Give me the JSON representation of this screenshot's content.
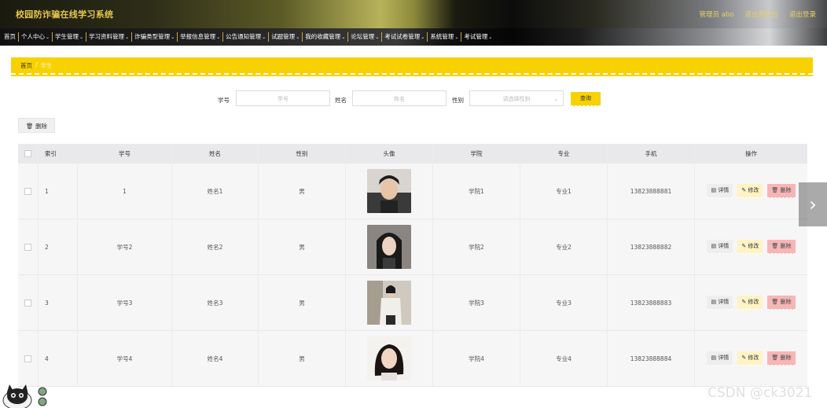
{
  "app": {
    "title": "校园防诈骗在线学习系统"
  },
  "top_right": {
    "user_label": "管理员 abo",
    "back_label": "退出到前台",
    "logout_label": "退出登录"
  },
  "nav": [
    {
      "label": "首页",
      "has_menu": false
    },
    {
      "label": "个人中心",
      "has_menu": true
    },
    {
      "label": "学生管理",
      "has_menu": true
    },
    {
      "label": "学习资料管理",
      "has_menu": true
    },
    {
      "label": "诈骗类型管理",
      "has_menu": true
    },
    {
      "label": "举报信息管理",
      "has_menu": true
    },
    {
      "label": "公告通知管理",
      "has_menu": true
    },
    {
      "label": "试题管理",
      "has_menu": true
    },
    {
      "label": "我的收藏管理",
      "has_menu": true
    },
    {
      "label": "论坛管理",
      "has_menu": true
    },
    {
      "label": "考试试卷管理",
      "has_menu": true
    },
    {
      "label": "系统管理",
      "has_menu": true
    },
    {
      "label": "考试管理",
      "has_menu": true
    }
  ],
  "breadcrumb": {
    "home": "首页",
    "separator": "/",
    "current": "学生"
  },
  "search": {
    "student_id_label": "学号",
    "student_id_placeholder": "学号",
    "name_label": "姓名",
    "name_placeholder": "姓名",
    "gender_label": "性别",
    "gender_placeholder": "请选择性别",
    "query_label": "查询"
  },
  "toolbar": {
    "delete_label": "删除"
  },
  "table": {
    "headers": {
      "index": "索引",
      "student_id": "学号",
      "name": "姓名",
      "gender": "性别",
      "avatar": "头像",
      "college": "学院",
      "major": "专业",
      "phone": "手机",
      "actions": "操作"
    },
    "rows": [
      {
        "index": "1",
        "student_id": "1",
        "name": "姓名1",
        "gender": "男",
        "college": "学院1",
        "major": "专业1",
        "phone": "13823888881"
      },
      {
        "index": "2",
        "student_id": "学号2",
        "name": "姓名2",
        "gender": "男",
        "college": "学院2",
        "major": "专业2",
        "phone": "13823888882"
      },
      {
        "index": "3",
        "student_id": "学号3",
        "name": "姓名3",
        "gender": "男",
        "college": "学院3",
        "major": "专业3",
        "phone": "13823888883"
      },
      {
        "index": "4",
        "student_id": "学号4",
        "name": "姓名4",
        "gender": "男",
        "college": "学院4",
        "major": "专业4",
        "phone": "13823888884"
      }
    ],
    "actions": {
      "detail": "详情",
      "edit": "修改",
      "delete": "删除"
    }
  },
  "watermark": "CSDN @ck3021",
  "colors": {
    "accent": "#f7d200",
    "delete": "#f5b6b6",
    "edit": "#fdf3c5"
  }
}
